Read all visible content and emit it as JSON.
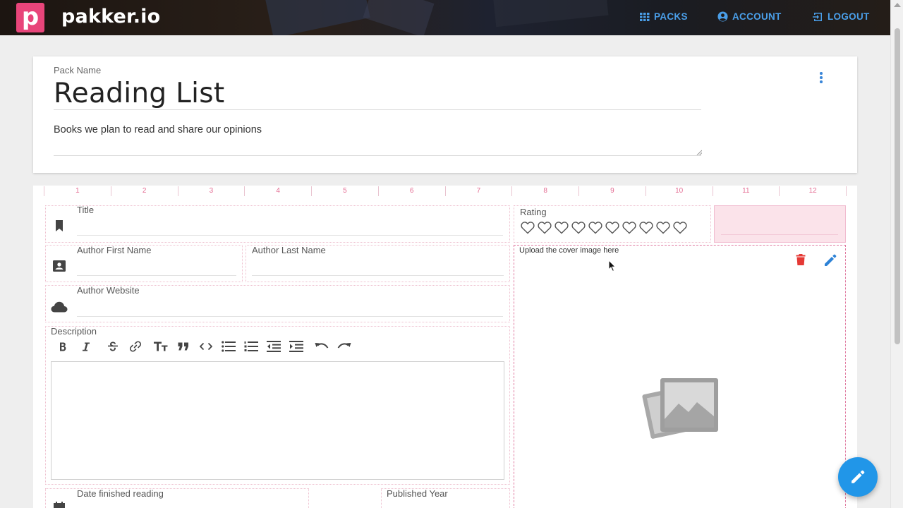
{
  "app": {
    "logo_letter": "p",
    "brand": "pakker.io",
    "accent": "#2196e8",
    "brand_pink": "#e8457a"
  },
  "nav": {
    "packs": "PACKS",
    "account": "ACCOUNT",
    "logout": "LOGOUT"
  },
  "pack": {
    "name_label": "Pack Name",
    "name": "Reading List",
    "description": "Books we plan to read and share our opinions"
  },
  "grid_columns": [
    "1",
    "2",
    "3",
    "4",
    "5",
    "6",
    "7",
    "8",
    "9",
    "10",
    "11",
    "12"
  ],
  "fields": {
    "title": {
      "label": "Title",
      "icon": "bookmark-icon"
    },
    "rating": {
      "label": "Rating",
      "max": 10,
      "value": 0
    },
    "author_first": {
      "label": "Author First Name",
      "icon": "contact-card-icon"
    },
    "author_last": {
      "label": "Author Last Name"
    },
    "author_website": {
      "label": "Author Website",
      "icon": "cloud-icon"
    },
    "description": {
      "label": "Description"
    },
    "cover": {
      "label": "Upload the cover image here"
    },
    "date_finished": {
      "label": "Date finished reading",
      "icon": "calendar-icon"
    },
    "published_year": {
      "label": "Published Year"
    }
  },
  "toolbar": [
    "bold",
    "italic",
    "strikethrough",
    "link",
    "heading",
    "quote",
    "code",
    "bullet-list",
    "numbered-list",
    "outdent",
    "indent",
    "undo",
    "redo"
  ]
}
